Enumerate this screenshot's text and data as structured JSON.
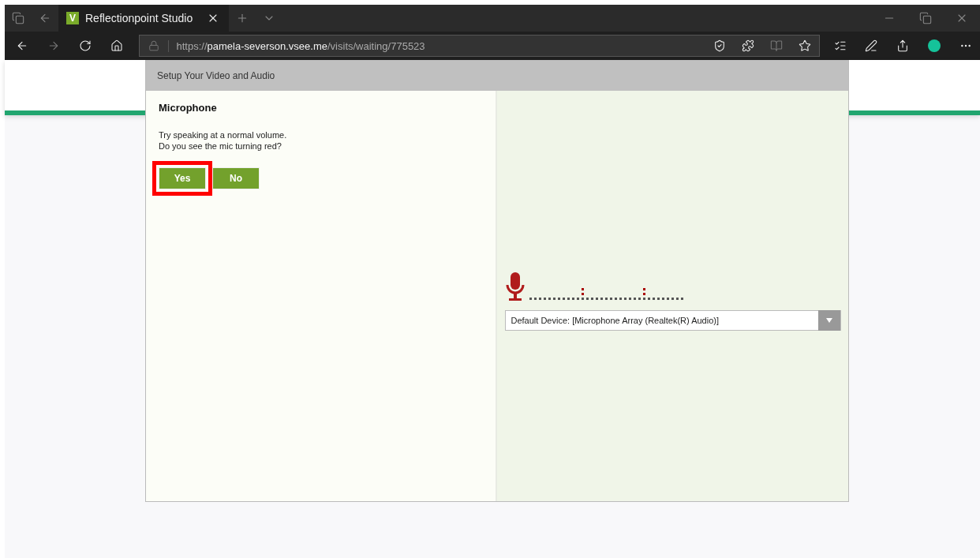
{
  "browser": {
    "tab": {
      "favicon": "V",
      "title": "Reflectionpoint Studio"
    },
    "url": {
      "scheme": "https://",
      "host": "pamela-severson.vsee.me",
      "path": "/visits/waiting/775523"
    }
  },
  "dialog": {
    "title": "Setup Your Video and Audio",
    "section_title": "Microphone",
    "prompt_lines": [
      "Try speaking at a normal volume.",
      "Do you see the mic turning red?"
    ],
    "buttons": [
      {
        "label": "Yes",
        "highlighted": true
      },
      {
        "label": "No",
        "highlighted": false
      }
    ],
    "device_select": {
      "value": "Default Device: [Microphone Array (Realtek(R) Audio)]"
    }
  }
}
